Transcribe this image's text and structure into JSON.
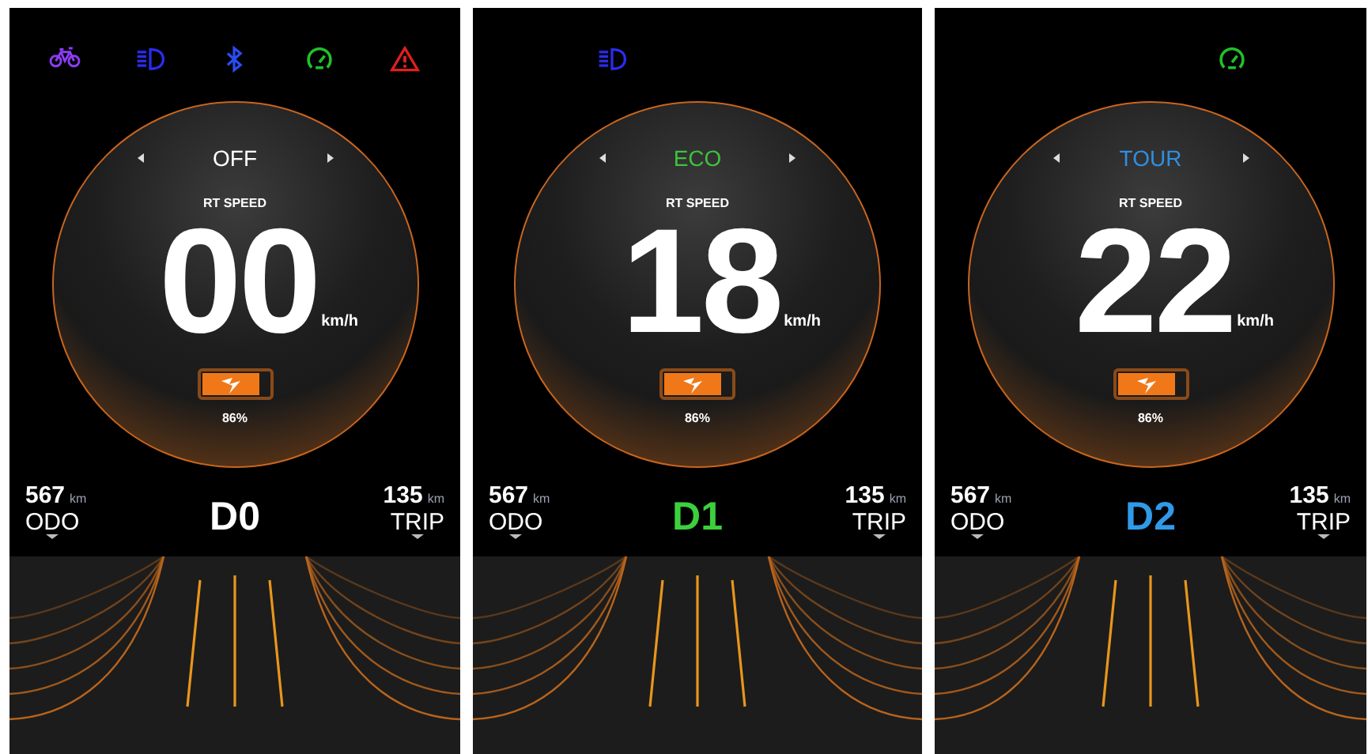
{
  "screens": [
    {
      "indicators": [
        {
          "kind": "bike",
          "color": "#8b3cf5"
        },
        {
          "kind": "headlight",
          "color": "#2a2cf0"
        },
        {
          "kind": "bluetooth",
          "color": "#2a4cf0"
        },
        {
          "kind": "speedometer",
          "color": "#22c02a"
        },
        {
          "kind": "warning",
          "color": "#e01f1f"
        }
      ],
      "mode": {
        "text": "OFF",
        "color": "#ffffff"
      },
      "speed_label": "RT SPEED",
      "speed": "00",
      "speed_unit": "km/h",
      "battery": {
        "level": 0.86,
        "reading": "86%"
      },
      "odo": {
        "value": "567",
        "unit": "km",
        "label": "ODO"
      },
      "gear": {
        "text": "D0",
        "color": "#ffffff"
      },
      "trip": {
        "value": "135",
        "unit": "km",
        "label": "TRIP"
      }
    },
    {
      "indicators": [
        {
          "kind": "headlight",
          "color": "#2a2cf0"
        }
      ],
      "mode": {
        "text": "ECO",
        "color": "#3cc43c"
      },
      "speed_label": "RT SPEED",
      "speed": "18",
      "speed_unit": "km/h",
      "battery": {
        "level": 0.86,
        "reading": "86%"
      },
      "odo": {
        "value": "567",
        "unit": "km",
        "label": "ODO"
      },
      "gear": {
        "text": "D1",
        "color": "#3cd03c"
      },
      "trip": {
        "value": "135",
        "unit": "km",
        "label": "TRIP"
      }
    },
    {
      "indicators": [
        {
          "kind": "speedometer",
          "color": "#22c02a"
        }
      ],
      "mode": {
        "text": "TOUR",
        "color": "#2f8fe0"
      },
      "speed_label": "RT SPEED",
      "speed": "22",
      "speed_unit": "km/h",
      "battery": {
        "level": 0.86,
        "reading": "86%"
      },
      "odo": {
        "value": "567",
        "unit": "km",
        "label": "ODO"
      },
      "gear": {
        "text": "D2",
        "color": "#2f9ae8"
      },
      "trip": {
        "value": "135",
        "unit": "km",
        "label": "TRIP"
      }
    }
  ]
}
